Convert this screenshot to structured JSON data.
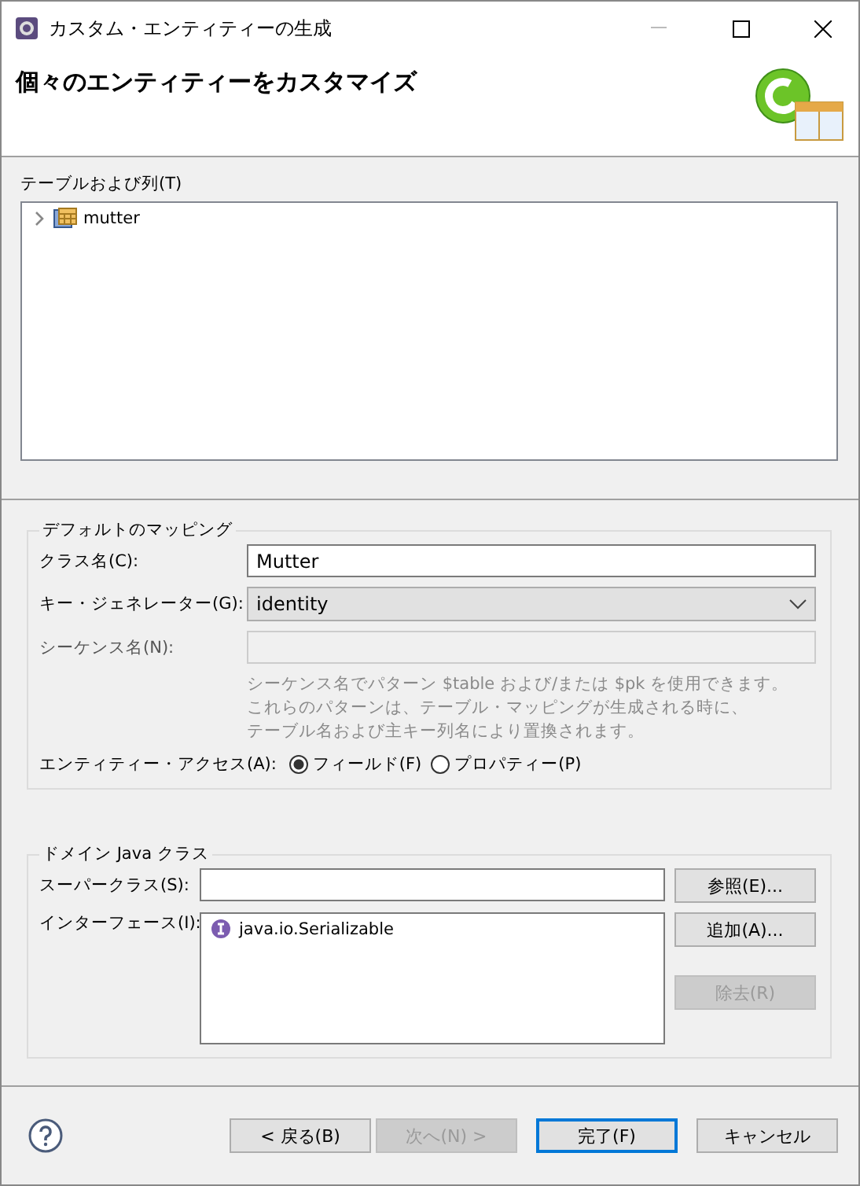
{
  "window": {
    "title": "カスタム・エンティティーの生成"
  },
  "header": {
    "title": "個々のエンティティーをカスタマイズ"
  },
  "tables": {
    "label": "テーブルおよび列(T)",
    "items": [
      {
        "name": "mutter",
        "expanded": false
      }
    ]
  },
  "mapping": {
    "title": "デフォルトのマッピング",
    "class_name": {
      "label": "クラス名(C):",
      "value": "Mutter"
    },
    "key_generator": {
      "label": "キー・ジェネレーター(G):",
      "value": "identity"
    },
    "sequence": {
      "label": "シーケンス名(N):",
      "disabled": true
    },
    "note": [
      "シーケンス名でパターン $table および/または $pk を使用できます。",
      "これらのパターンは、テーブル・マッピングが生成される時に、",
      "テーブル名および主キー列名により置換されます。"
    ],
    "access": {
      "label": "エンティティー・アクセス(A):",
      "options": [
        {
          "label": "フィールド(F)",
          "selected": true
        },
        {
          "label": "プロパティー(P)",
          "selected": false
        }
      ]
    }
  },
  "domain": {
    "title": "ドメイン Java クラス",
    "superclass": {
      "label": "スーパークラス(S):"
    },
    "browse_button": {
      "label": "参照(E)...",
      "disabled": false
    },
    "interfaces": {
      "label": "インターフェース(I):",
      "items": [
        "java.io.Serializable"
      ]
    },
    "add_button": {
      "label": "追加(A)...",
      "disabled": false
    },
    "remove_button": {
      "label": "除去(R)",
      "disabled": true
    }
  },
  "buttons": [
    {
      "label": "< 戻る(B)",
      "disabled": false,
      "default": false
    },
    {
      "label": "次へ(N) >",
      "disabled": true,
      "default": false
    },
    {
      "label": "完了(F)",
      "disabled": false,
      "default": true
    },
    {
      "label": "キャンセル",
      "disabled": false,
      "default": false
    }
  ]
}
